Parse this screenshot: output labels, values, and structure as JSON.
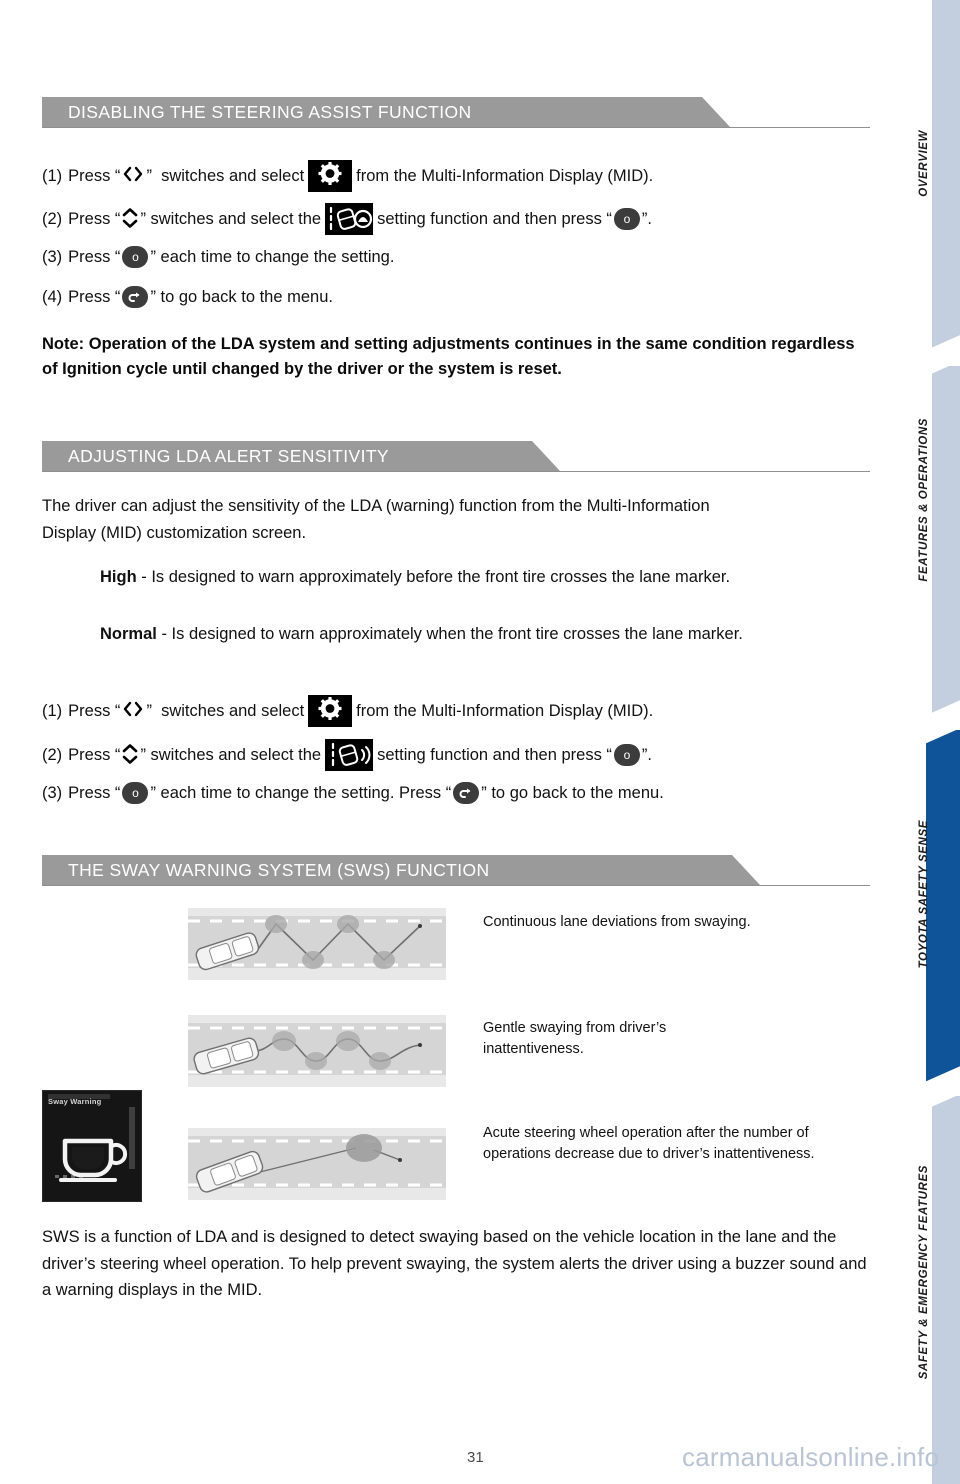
{
  "page": {
    "number": "31",
    "watermark": "carmanualsonline.info"
  },
  "sidebar": {
    "tabs": [
      {
        "label": "OVERVIEW",
        "active": false
      },
      {
        "label": "FEATURES & OPERATIONS",
        "active": false
      },
      {
        "label": "TOYOTA SAFETY SENSE",
        "active": true
      },
      {
        "label": "SAFETY & EMERGENCY FEATURES",
        "active": false
      }
    ],
    "active_color": "#0f5499",
    "inactive_color": "#c3cfdf"
  },
  "sections": [
    {
      "id": "disabling-steering-assist",
      "banner": "DISABLING THE STEERING ASSIST FUNCTION",
      "steps": [
        {
          "num": "(1)",
          "parts": [
            "Press “",
            "ARROW_LR",
            "”  switches and select ",
            "CHIP_GEAR",
            " from the Multi-Information Display (MID)."
          ]
        },
        {
          "num": "(2)",
          "parts": [
            "Press “",
            "ARROW_UD",
            "” switches and select the ",
            "CHIP_LDA",
            " setting function and then press “",
            "BTN_OK",
            "”."
          ]
        },
        {
          "num": "(3)",
          "parts": [
            "Press “",
            "BTN_OK",
            "” each time to change the setting."
          ]
        },
        {
          "num": "(4)",
          "parts": [
            "Press “",
            "BTN_BACK",
            "” to go back to the menu."
          ]
        }
      ],
      "note": "Note: Operation of the LDA system and setting adjustments continues in the same condition regardless of Ignition cycle until changed by the driver or the system is reset."
    },
    {
      "id": "adjusting-lda-alert-sensitivity",
      "banner": "ADJUSTING LDA ALERT SENSITIVITY",
      "intro": "The driver can adjust the sensitivity of the LDA (warning) function from the Multi-Information Display (MID) customization screen.",
      "levels": [
        {
          "name": "High",
          "desc": " - Is designed to warn approximately before the front tire crosses the lane marker."
        },
        {
          "name": "Normal",
          "desc": " - Is designed to warn approximately when the front tire crosses the lane marker."
        }
      ],
      "steps": [
        {
          "num": "(1)",
          "parts": [
            "Press “",
            "ARROW_LR",
            "”  switches and select ",
            "CHIP_GEAR",
            " from the Multi-Information Display (MID)."
          ]
        },
        {
          "num": "(2)",
          "parts": [
            "Press “",
            "ARROW_UD",
            "” switches and select the ",
            "CHIP_SENS",
            " setting function and then press “",
            "BTN_OK",
            "”."
          ]
        },
        {
          "num": "(3)",
          "parts": [
            "Press “",
            "BTN_OK",
            "” each time to change the setting. Press “",
            "BTN_BACK",
            "” to go back to the menu."
          ]
        }
      ]
    },
    {
      "id": "sway-warning-system",
      "banner": "THE SWAY WARNING SYSTEM (SWS) FUNCTION",
      "figures": [
        {
          "caption": "Continuous lane deviations from swaying.",
          "pattern": "zigzag"
        },
        {
          "caption": "Gentle swaying from driver’s inattentiveness.",
          "pattern": "wave"
        },
        {
          "caption": "Acute steering wheel operation after the number of operations decrease due to driver’s inattentiveness.",
          "pattern": "loop"
        }
      ],
      "mid_panel": {
        "title": "Sway Warning",
        "icon": "coffee-cup-icon"
      },
      "closing": "SWS is a function of LDA and is designed to detect swaying based on the vehicle location in the lane and the driver’s steering wheel operation. To help prevent swaying, the system alerts the driver using a buzzer sound and a warning displays in the MID."
    }
  ],
  "buttons": {
    "ok_label": "o",
    "back_label": "↶"
  },
  "arrows": {
    "left_right": "‹›",
    "up_down": "⌃⌄"
  }
}
